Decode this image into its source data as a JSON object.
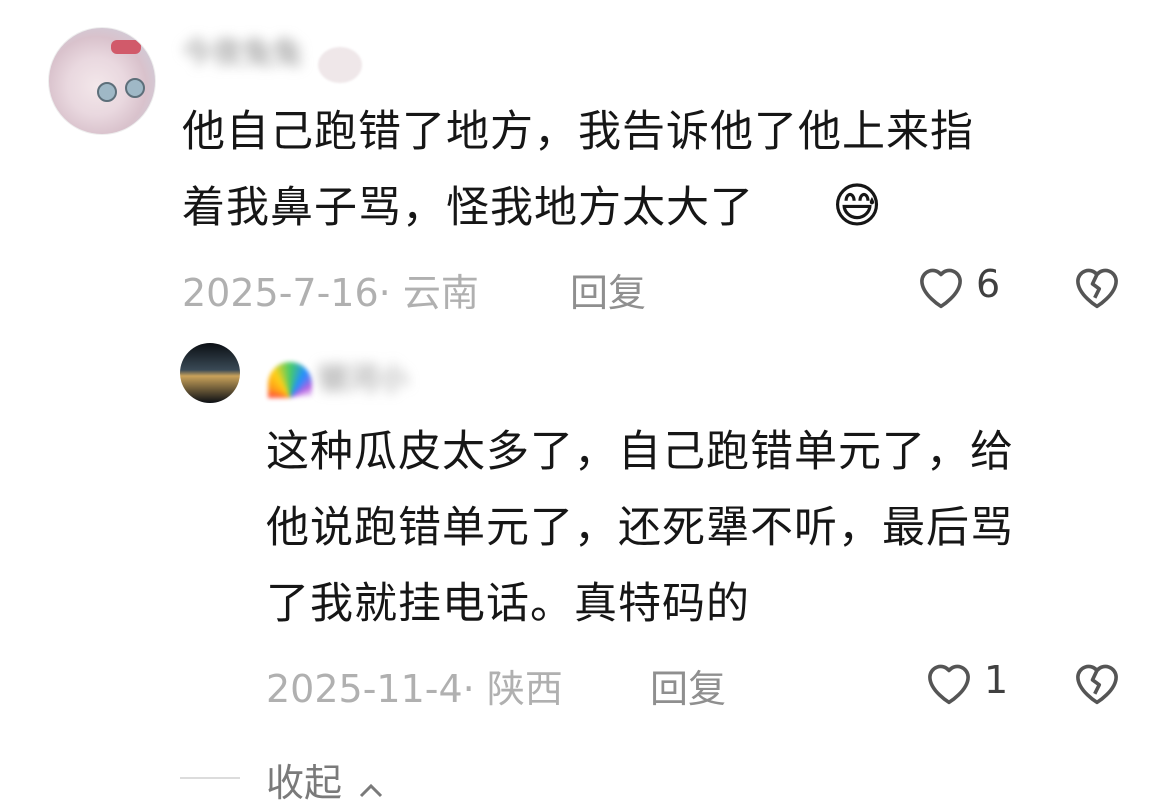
{
  "comments": [
    {
      "author": "今夜兔兔",
      "text_line1": "他自己跑错了地方，我告诉他了他上来指",
      "text_line2": "着我鼻子骂，怪我地方太大了",
      "emoji": "😅",
      "date_location": "2025-7-16· 云南",
      "reply_label": "回复",
      "likes": "6"
    },
    {
      "author": "银河小",
      "text_line1": "这种瓜皮太多了，自己跑错单元了，给",
      "text_line2": "他说跑错单元了，还死犟不听，最后骂",
      "text_line3": "了我就挂电话。真特码的",
      "date_location": "2025-11-4· 陕西",
      "reply_label": "回复",
      "likes": "1"
    }
  ],
  "collapse_label": "收起",
  "icons": {
    "heart": "heart-icon",
    "dislike": "broken-heart-icon",
    "chevron": "chevron-up-icon"
  },
  "colors": {
    "text": "#161616",
    "meta": "#b0b0b0",
    "icon": "#555555"
  }
}
